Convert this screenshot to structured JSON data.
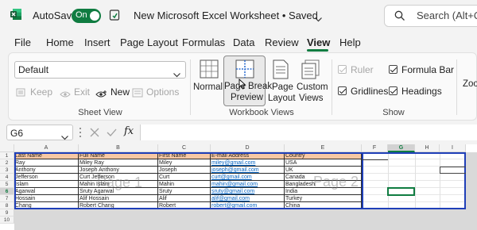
{
  "title_bar": {
    "app_icon": "excel-icon",
    "autosave_label": "AutoSave",
    "autosave_state": "On",
    "file_title": "New Microsoft Excel Worksheet • Saved",
    "search_placeholder": "Search (Alt+Q)"
  },
  "menu": {
    "items": [
      "File",
      "Home",
      "Insert",
      "Page Layout",
      "Formulas",
      "Data",
      "Review",
      "View",
      "Help"
    ],
    "active": "View"
  },
  "ribbon": {
    "sheet_view": {
      "dropdown_value": "Default",
      "keep": "Keep",
      "exit": "Exit",
      "new": "New",
      "options": "Options",
      "group_label": "Sheet View"
    },
    "workbook_views": {
      "normal": "Normal",
      "page_break_preview_line1": "Page Break",
      "page_break_preview_line2": "Preview",
      "page_layout_line1": "Page",
      "page_layout_line2": "Layout",
      "custom_views_line1": "Custom",
      "custom_views_line2": "Views",
      "group_label": "Workbook Views"
    },
    "show": {
      "ruler": "Ruler",
      "formula_bar": "Formula Bar",
      "gridlines": "Gridlines",
      "headings": "Headings",
      "group_label": "Show"
    },
    "zoom_partial": "Zoo"
  },
  "formula_bar": {
    "name_box": "G6",
    "fx": "fx",
    "value": ""
  },
  "sheet": {
    "columns": [
      "A",
      "B",
      "C",
      "D",
      "E",
      "F",
      "G",
      "H",
      "I"
    ],
    "rows": [
      "1",
      "2",
      "3",
      "4",
      "5",
      "6",
      "7",
      "8",
      "9",
      "10"
    ],
    "headers": [
      "Last Name",
      "Full Name",
      "First Name",
      "E-mail Address",
      "Country"
    ],
    "data": [
      [
        "Ray",
        "Miley Ray",
        "Miley",
        "miley@gmail.com",
        "USA"
      ],
      [
        "Anthony",
        "Joseph Anthony",
        "Joseph",
        "joseph@gmail.com",
        "UK"
      ],
      [
        "Jefferson",
        "Curt Jefferson",
        "Curt",
        "curt@gmail.com",
        "Canada"
      ],
      [
        "Islam",
        "Mahin Islam",
        "Mahin",
        "mahin@gmail.com",
        "Bangladesh"
      ],
      [
        "Agarwal",
        "Sruty Agarwal",
        "Sruty",
        "sruty@gmail.com",
        "India"
      ],
      [
        "Hossain",
        "Alif Hossain",
        "Alif",
        "alif@gmail.com",
        "Turkey"
      ],
      [
        "Chang",
        "Robert Chang",
        "Robert",
        "robert@gmail.com",
        "China"
      ]
    ],
    "watermark_page1": "Page 1",
    "watermark_page2": "Page 2"
  }
}
